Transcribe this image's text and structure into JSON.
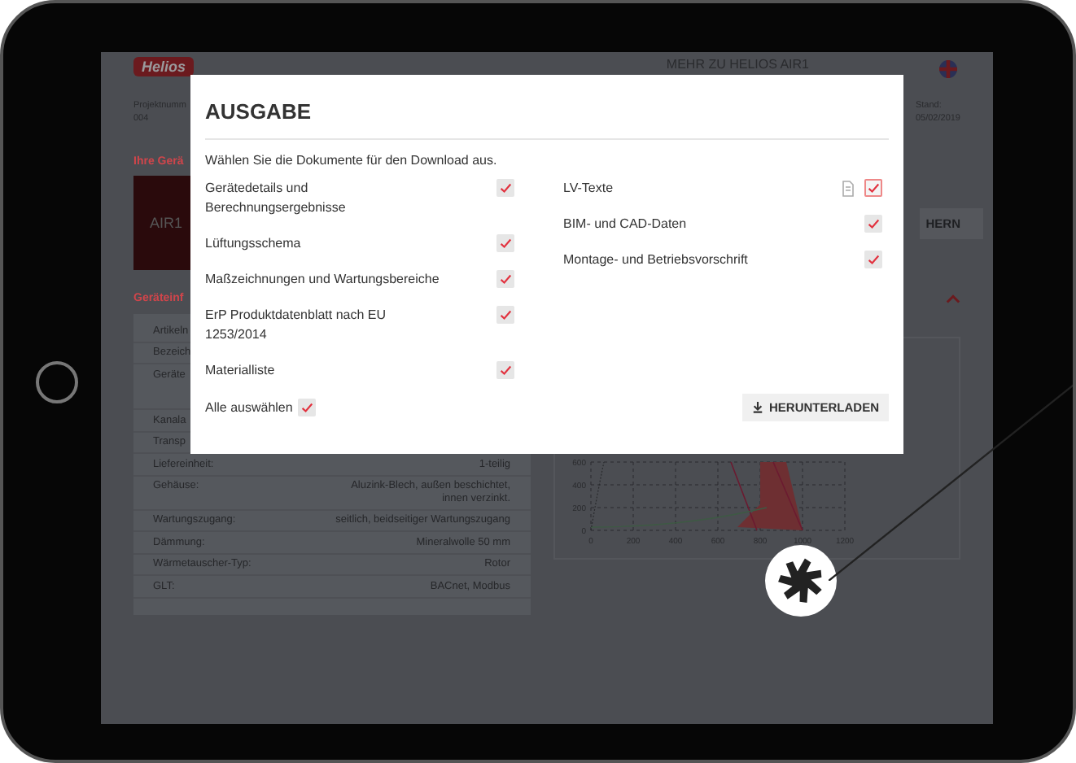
{
  "header": {
    "logo": "Helios",
    "link": "MEHR ZU HELIOS AIR1"
  },
  "project": {
    "label": "Projektnumm",
    "value": "004"
  },
  "date": {
    "label": "Stand:",
    "value": "05/02/2019"
  },
  "devices": {
    "heading": "Ihre Gerä",
    "device": "AIR1",
    "button": "HERN"
  },
  "info": {
    "heading": "Geräteinf",
    "expanded": true,
    "rows": [
      {
        "label": "Artikeln"
      },
      {
        "label": "Bezeich"
      },
      {
        "label": "Geräte",
        "tall": true
      },
      {
        "label": "Kanala"
      },
      {
        "label": "Transp"
      },
      {
        "label": "Liefereinheit:",
        "value": "1-teilig"
      },
      {
        "label": "Gehäuse:",
        "value": "Aluzink-Blech, außen beschichtet, innen verzinkt."
      },
      {
        "label": "Wartungszugang:",
        "value": "seitlich, beidseitiger Wartungszugang"
      },
      {
        "label": "Dämmung:",
        "value": "Mineralwolle 50 mm"
      },
      {
        "label": "Wärmetauscher-Typ:",
        "value": "Rotor"
      },
      {
        "label": "GLT:",
        "value": "BACnet, Modbus"
      }
    ]
  },
  "chart": {
    "x_ticks": [
      "0",
      "200",
      "400",
      "600",
      "800",
      "1000",
      "1200"
    ],
    "y_ticks": [
      "600",
      "400",
      "200",
      "0"
    ]
  },
  "dialog": {
    "title": "AUSGABE",
    "intro": "Wählen Sie die Dokumente für den Download aus.",
    "left": [
      {
        "label": "Gerätedetails und Berechnungsergebnisse",
        "checked": true,
        "kind": "plain",
        "focused": false
      },
      {
        "label": "Lüftungsschema",
        "checked": true,
        "kind": "plain",
        "focused": false
      },
      {
        "label": "Maßzeichnungen und Wartungsbereiche",
        "checked": true,
        "kind": "plain",
        "focused": false
      },
      {
        "label": "ErP Produktdatenblatt nach EU 1253/2014",
        "checked": true,
        "kind": "plain",
        "focused": false
      },
      {
        "label": "Materialliste",
        "checked": true,
        "kind": "plain",
        "focused": false
      }
    ],
    "right": [
      {
        "label": "LV-Texte",
        "checked": true,
        "kind": "document",
        "focused": true
      },
      {
        "label": "BIM- und CAD-Daten",
        "checked": true,
        "kind": "plain",
        "focused": false
      },
      {
        "label": "Montage- und Betriebsvorschrift",
        "checked": true,
        "kind": "plain",
        "focused": false
      }
    ],
    "select_all": {
      "label": "Alle auswählen",
      "checked": true
    },
    "button": "HERUNTERLADEN"
  }
}
